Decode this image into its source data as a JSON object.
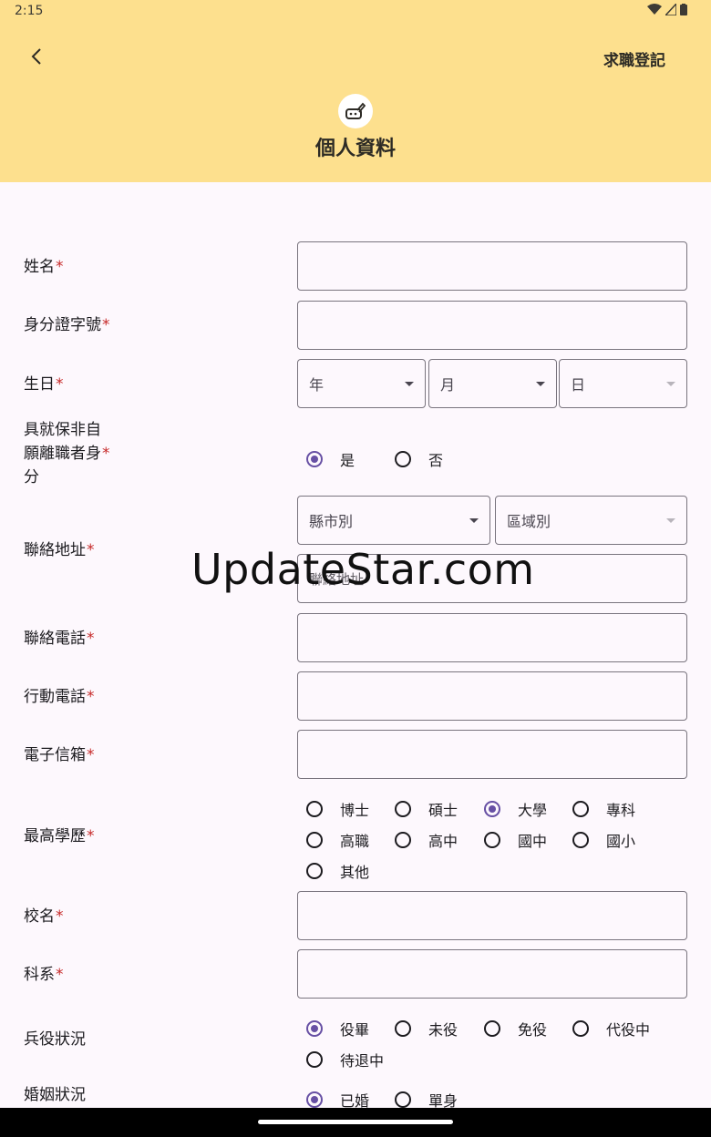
{
  "status": {
    "time": "2:15"
  },
  "header": {
    "action": "求職登記",
    "title": "個人資料"
  },
  "fields": {
    "name": {
      "label": "姓名",
      "req": "*"
    },
    "id": {
      "label": "身分證字號",
      "req": "*"
    },
    "birthday": {
      "label": "生日",
      "req": "*",
      "year": "年",
      "month": "月",
      "day": "日"
    },
    "unemployed": {
      "line1": "具就保非自",
      "line2": "願離職者身",
      "line3": "分",
      "req": "*",
      "opt_yes": "是",
      "opt_no": "否"
    },
    "address": {
      "label": "聯絡地址",
      "req": "*",
      "city": "縣市別",
      "district": "區域別",
      "placeholder": "聯絡地址"
    },
    "phone": {
      "label": "聯絡電話",
      "req": "*"
    },
    "mobile": {
      "label": "行動電話",
      "req": "*"
    },
    "email": {
      "label": "電子信箱",
      "req": "*"
    },
    "education": {
      "label": "最高學歷",
      "req": "*",
      "options": [
        "博士",
        "碩士",
        "大學",
        "專科",
        "高職",
        "高中",
        "國中",
        "國小",
        "其他"
      ]
    },
    "school": {
      "label": "校名",
      "req": "*"
    },
    "department": {
      "label": "科系",
      "req": "*"
    },
    "military": {
      "label": "兵役狀況",
      "options": [
        "役畢",
        "未役",
        "免役",
        "代役中",
        "待退中"
      ]
    },
    "marital": {
      "label": "婚姻狀況",
      "options": [
        "已婚",
        "單身"
      ]
    }
  },
  "watermark": "UpdateStar.com"
}
